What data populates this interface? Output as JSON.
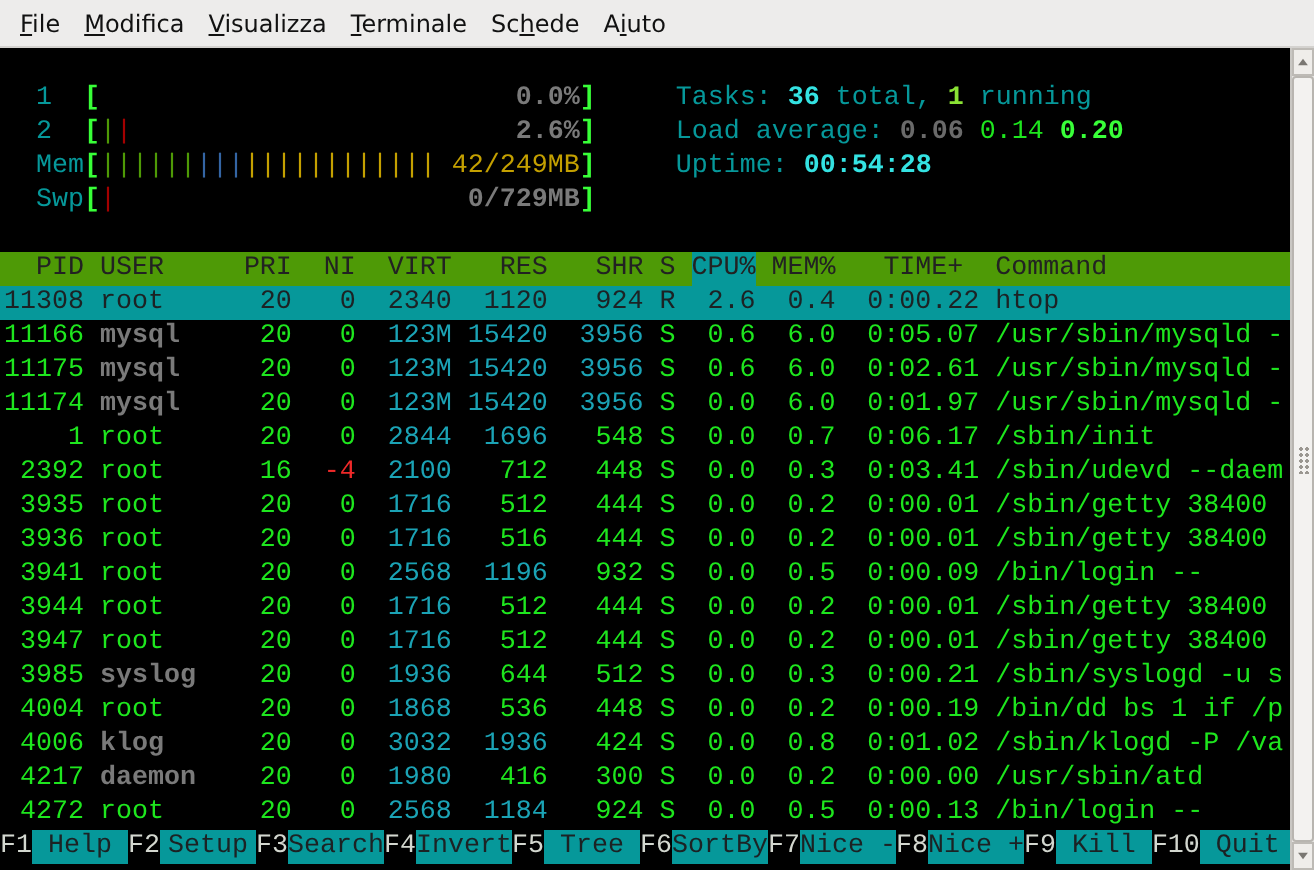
{
  "menu": [
    {
      "accel": "F",
      "rest": "ile"
    },
    {
      "accel": "M",
      "rest": "odifica"
    },
    {
      "accel": "V",
      "rest": "isualizza"
    },
    {
      "accel": "T",
      "rest": "erminale"
    },
    {
      "before": "Sc",
      "accel": "h",
      "rest": "ede"
    },
    {
      "before": "A",
      "accel": "i",
      "rest": "uto"
    }
  ],
  "meters": [
    {
      "label": "1",
      "kind": "cpu",
      "open": "[",
      "value": "0.0%",
      "close": "]"
    },
    {
      "label": "2",
      "kind": "cpu",
      "open": "[",
      "bars": [
        {
          "text": "|",
          "color": "#4e9a06"
        },
        {
          "text": "|",
          "color": "#a40000"
        }
      ],
      "value": "2.6%",
      "close": "]"
    },
    {
      "label": "Mem",
      "kind": "mem",
      "open": "[",
      "bars": [
        {
          "text": "||||||",
          "color": "#4e9a06"
        },
        {
          "text": "|||",
          "color": "#3465a4"
        },
        {
          "text": "||||||||||||",
          "color": "#c4a000"
        }
      ],
      "value": "42/249MB",
      "close": "]"
    },
    {
      "label": "Swp",
      "kind": "swap",
      "open": "[",
      "bars": [
        {
          "text": "|",
          "color": "#a40000"
        }
      ],
      "value": "0/729MB",
      "close": "]"
    }
  ],
  "summary": [
    {
      "parts": [
        {
          "text": "Tasks: ",
          "kind": "label"
        },
        {
          "text": "36",
          "kind": "value"
        },
        {
          "text": " total, ",
          "kind": "label"
        },
        {
          "text": "1",
          "kind": "running"
        },
        {
          "text": " running",
          "kind": "label"
        }
      ]
    },
    {
      "parts": [
        {
          "text": "Load average: ",
          "kind": "label"
        },
        {
          "text": "0.06",
          "kind": "load_low"
        },
        {
          "text": " 0.14",
          "kind": "load_mid"
        },
        {
          "text": " 0.20",
          "kind": "load_high"
        }
      ]
    },
    {
      "parts": [
        {
          "text": "Uptime: ",
          "kind": "label"
        },
        {
          "text": "00:54:28",
          "kind": "value"
        }
      ]
    }
  ],
  "columns": [
    {
      "label": "PID",
      "sorted": false
    },
    {
      "label": "USER",
      "sorted": false
    },
    {
      "label": "PRI",
      "sorted": false
    },
    {
      "label": "NI",
      "sorted": false
    },
    {
      "label": "VIRT",
      "sorted": false
    },
    {
      "label": "RES",
      "sorted": false
    },
    {
      "label": "SHR",
      "sorted": false
    },
    {
      "label": "S",
      "sorted": false
    },
    {
      "label": "CPU%",
      "sorted": true
    },
    {
      "label": "MEM%",
      "sorted": false
    },
    {
      "label": "TIME+",
      "sorted": false
    },
    {
      "label": "Command",
      "sorted": false
    }
  ],
  "rows": [
    {
      "cells": [
        "11308",
        "root",
        "20",
        "0",
        "2340",
        "1120",
        "924",
        "R",
        "2.6",
        "0.4",
        "0:00.22",
        "htop"
      ],
      "selected": true,
      "system_user": false,
      "negative_nice": false
    },
    {
      "cells": [
        "11166",
        "mysql",
        "20",
        "0",
        "123M",
        "15420",
        "3956",
        "S",
        "0.6",
        "6.0",
        "0:05.07",
        "/usr/sbin/mysqld -"
      ],
      "selected": false,
      "system_user": true,
      "negative_nice": false,
      "large": [
        true,
        true,
        true
      ]
    },
    {
      "cells": [
        "11175",
        "mysql",
        "20",
        "0",
        "123M",
        "15420",
        "3956",
        "S",
        "0.6",
        "6.0",
        "0:02.61",
        "/usr/sbin/mysqld -"
      ],
      "selected": false,
      "system_user": true,
      "negative_nice": false,
      "large": [
        true,
        true,
        true
      ]
    },
    {
      "cells": [
        "11174",
        "mysql",
        "20",
        "0",
        "123M",
        "15420",
        "3956",
        "S",
        "0.0",
        "6.0",
        "0:01.97",
        "/usr/sbin/mysqld -"
      ],
      "selected": false,
      "system_user": true,
      "negative_nice": false,
      "large": [
        true,
        true,
        true
      ]
    },
    {
      "cells": [
        "1",
        "root",
        "20",
        "0",
        "2844",
        "1696",
        "548",
        "S",
        "0.0",
        "0.7",
        "0:06.17",
        "/sbin/init"
      ],
      "selected": false,
      "system_user": false,
      "negative_nice": false,
      "large": [
        true,
        true,
        false
      ]
    },
    {
      "cells": [
        "2392",
        "root",
        "16",
        "-4",
        "2100",
        "712",
        "448",
        "S",
        "0.0",
        "0.3",
        "0:03.41",
        "/sbin/udevd --daem"
      ],
      "selected": false,
      "system_user": false,
      "negative_nice": true,
      "large": [
        true,
        false,
        false
      ]
    },
    {
      "cells": [
        "3935",
        "root",
        "20",
        "0",
        "1716",
        "512",
        "444",
        "S",
        "0.0",
        "0.2",
        "0:00.01",
        "/sbin/getty 38400"
      ],
      "selected": false,
      "system_user": false,
      "negative_nice": false,
      "large": [
        true,
        false,
        false
      ]
    },
    {
      "cells": [
        "3936",
        "root",
        "20",
        "0",
        "1716",
        "516",
        "444",
        "S",
        "0.0",
        "0.2",
        "0:00.01",
        "/sbin/getty 38400"
      ],
      "selected": false,
      "system_user": false,
      "negative_nice": false,
      "large": [
        true,
        false,
        false
      ]
    },
    {
      "cells": [
        "3941",
        "root",
        "20",
        "0",
        "2568",
        "1196",
        "932",
        "S",
        "0.0",
        "0.5",
        "0:00.09",
        "/bin/login --"
      ],
      "selected": false,
      "system_user": false,
      "negative_nice": false,
      "large": [
        true,
        true,
        false
      ]
    },
    {
      "cells": [
        "3944",
        "root",
        "20",
        "0",
        "1716",
        "512",
        "444",
        "S",
        "0.0",
        "0.2",
        "0:00.01",
        "/sbin/getty 38400"
      ],
      "selected": false,
      "system_user": false,
      "negative_nice": false,
      "large": [
        true,
        false,
        false
      ]
    },
    {
      "cells": [
        "3947",
        "root",
        "20",
        "0",
        "1716",
        "512",
        "444",
        "S",
        "0.0",
        "0.2",
        "0:00.01",
        "/sbin/getty 38400"
      ],
      "selected": false,
      "system_user": false,
      "negative_nice": false,
      "large": [
        true,
        false,
        false
      ]
    },
    {
      "cells": [
        "3985",
        "syslog",
        "20",
        "0",
        "1936",
        "644",
        "512",
        "S",
        "0.0",
        "0.3",
        "0:00.21",
        "/sbin/syslogd -u s"
      ],
      "selected": false,
      "system_user": true,
      "negative_nice": false,
      "large": [
        true,
        false,
        false
      ]
    },
    {
      "cells": [
        "4004",
        "root",
        "20",
        "0",
        "1868",
        "536",
        "448",
        "S",
        "0.0",
        "0.2",
        "0:00.19",
        "/bin/dd bs 1 if /p"
      ],
      "selected": false,
      "system_user": false,
      "negative_nice": false,
      "large": [
        true,
        false,
        false
      ]
    },
    {
      "cells": [
        "4006",
        "klog",
        "20",
        "0",
        "3032",
        "1936",
        "424",
        "S",
        "0.0",
        "0.8",
        "0:01.02",
        "/sbin/klogd -P /va"
      ],
      "selected": false,
      "system_user": true,
      "negative_nice": false,
      "large": [
        true,
        true,
        false
      ]
    },
    {
      "cells": [
        "4217",
        "daemon",
        "20",
        "0",
        "1980",
        "416",
        "300",
        "S",
        "0.0",
        "0.2",
        "0:00.00",
        "/usr/sbin/atd"
      ],
      "selected": false,
      "system_user": true,
      "negative_nice": false,
      "large": [
        true,
        false,
        false
      ]
    },
    {
      "cells": [
        "4272",
        "root",
        "20",
        "0",
        "2568",
        "1184",
        "924",
        "S",
        "0.0",
        "0.5",
        "0:00.13",
        "/bin/login --"
      ],
      "selected": false,
      "system_user": false,
      "negative_nice": false,
      "large": [
        true,
        true,
        false
      ]
    }
  ],
  "function_keys": [
    {
      "key": "F1",
      "label": "Help"
    },
    {
      "key": "F2",
      "label": "Setup"
    },
    {
      "key": "F3",
      "label": "Search"
    },
    {
      "key": "F4",
      "label": "Invert"
    },
    {
      "key": "F5",
      "label": "Tree"
    },
    {
      "key": "F6",
      "label": "SortBy"
    },
    {
      "key": "F7",
      "label": "Nice -"
    },
    {
      "key": "F8",
      "label": "Nice +"
    },
    {
      "key": "F9",
      "label": "Kill"
    },
    {
      "key": "F10",
      "label": "Quit"
    }
  ]
}
